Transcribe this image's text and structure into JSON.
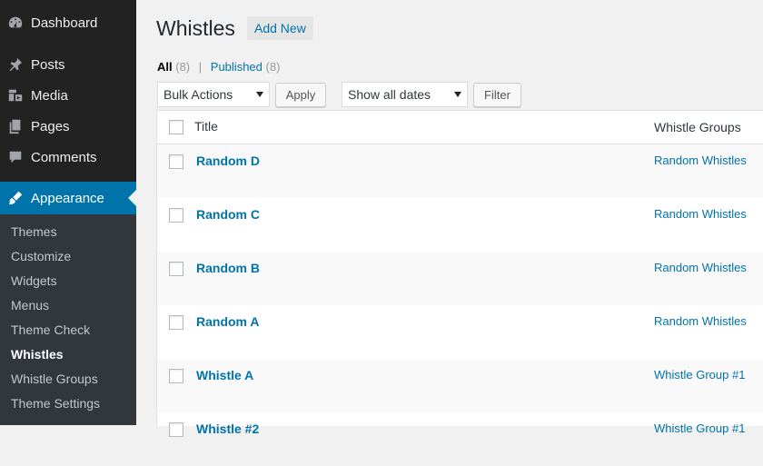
{
  "sidebar": {
    "menu": [
      {
        "label": "Dashboard",
        "icon": "dashboard-icon"
      },
      {
        "label": "Posts",
        "icon": "pin-icon"
      },
      {
        "label": "Media",
        "icon": "media-icon"
      },
      {
        "label": "Pages",
        "icon": "pages-icon"
      },
      {
        "label": "Comments",
        "icon": "comment-icon"
      },
      {
        "label": "Appearance",
        "icon": "brush-icon"
      }
    ],
    "submenu": [
      "Themes",
      "Customize",
      "Widgets",
      "Menus",
      "Theme Check",
      "Whistles",
      "Whistle Groups",
      "Theme Settings"
    ],
    "active_color": "#0073aa"
  },
  "header": {
    "title": "Whistles",
    "add_new": "Add New"
  },
  "filters": {
    "all_label": "All",
    "all_count": "(8)",
    "separator": "|",
    "published_label": "Published",
    "published_count": "(8)"
  },
  "toolbar": {
    "bulk_actions": "Bulk Actions",
    "apply": "Apply",
    "dates": "Show all dates",
    "filter": "Filter"
  },
  "table": {
    "columns": {
      "title": "Title",
      "groups": "Whistle Groups"
    },
    "rows": [
      {
        "title": "Random D",
        "group": "Random Whistles"
      },
      {
        "title": "Random C",
        "group": "Random Whistles"
      },
      {
        "title": "Random B",
        "group": "Random Whistles"
      },
      {
        "title": "Random A",
        "group": "Random Whistles"
      },
      {
        "title": "Whistle A",
        "group": "Whistle Group #1"
      },
      {
        "title": "Whistle #2",
        "group": "Whistle Group #1"
      }
    ]
  }
}
